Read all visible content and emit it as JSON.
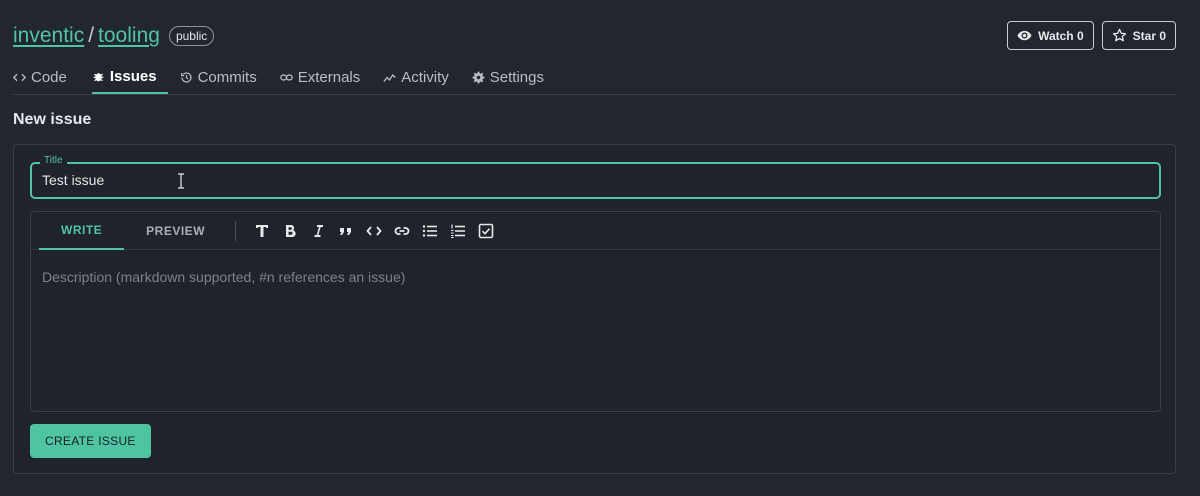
{
  "repo": {
    "owner": "inventic",
    "separator": "/",
    "name": "tooling",
    "visibility": "public"
  },
  "header_actions": {
    "watch_label": "Watch 0",
    "star_label": "Star 0"
  },
  "tabs": [
    {
      "label": "Code",
      "icon": "code-icon"
    },
    {
      "label": "Issues",
      "icon": "bug-icon"
    },
    {
      "label": "Commits",
      "icon": "history-icon"
    },
    {
      "label": "Externals",
      "icon": "link-icon"
    },
    {
      "label": "Activity",
      "icon": "activity-icon"
    },
    {
      "label": "Settings",
      "icon": "gear-icon"
    }
  ],
  "active_tab": "Issues",
  "page_title": "New issue",
  "form": {
    "title_legend": "Title",
    "title_value": "Test issue",
    "editor_tabs": {
      "write": "WRITE",
      "preview": "PREVIEW"
    },
    "toolbar_icons": [
      "heading-icon",
      "bold-icon",
      "italic-icon",
      "quote-icon",
      "code-icon",
      "link-icon",
      "bullet-list-icon",
      "numbered-list-icon",
      "checkbox-icon"
    ],
    "description_placeholder": "Description (markdown supported, #n references an issue)",
    "submit_label": "CREATE ISSUE"
  },
  "colors": {
    "accent": "#4fc4a3",
    "background": "#22262e"
  }
}
